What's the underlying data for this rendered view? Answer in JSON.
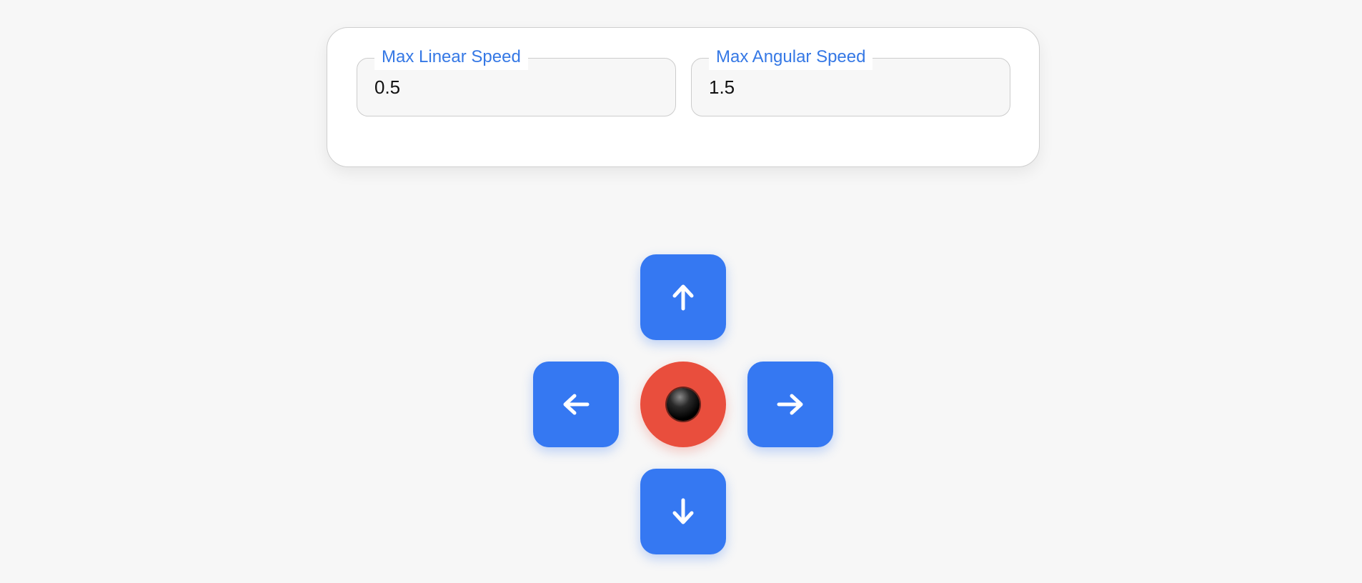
{
  "settings": {
    "max_linear_speed": {
      "label": "Max Linear Speed",
      "value": "0.5"
    },
    "max_angular_speed": {
      "label": "Max Angular Speed",
      "value": "1.5"
    }
  },
  "dpad": {
    "up_icon": "arrow-up-icon",
    "left_icon": "arrow-left-icon",
    "right_icon": "arrow-right-icon",
    "down_icon": "arrow-down-icon",
    "stop_icon": "black-circle-icon"
  },
  "colors": {
    "accent": "#3578f2",
    "label": "#3578e5",
    "stop": "#e94e3d",
    "background": "#f7f7f7",
    "card": "#ffffff"
  }
}
